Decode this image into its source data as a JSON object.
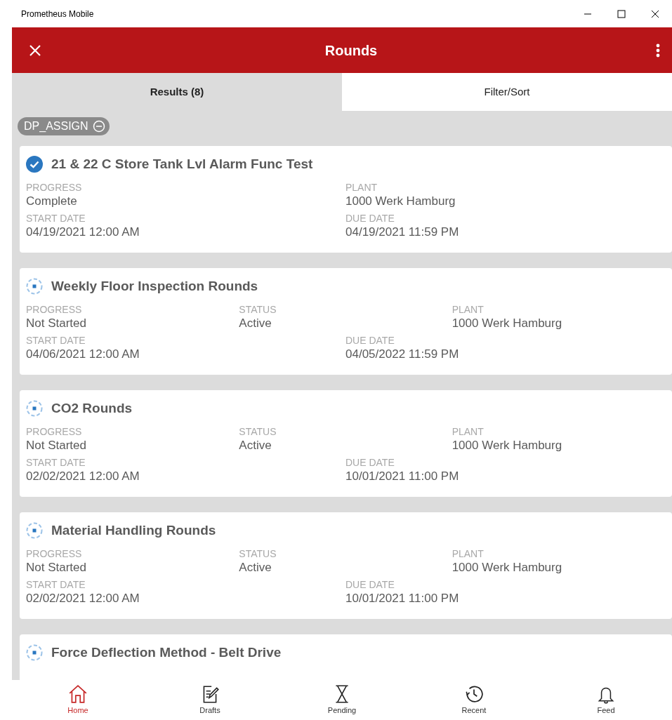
{
  "window": {
    "title": "Prometheus Mobile"
  },
  "header": {
    "title": "Rounds"
  },
  "tabs": [
    {
      "label": "Results (8)",
      "selected": true
    },
    {
      "label": "Filter/Sort",
      "selected": false
    }
  ],
  "filter_chips": [
    {
      "label": "DP_ASSIGN"
    }
  ],
  "rounds": [
    {
      "kind": "complete",
      "title": "21 & 22 C Store Tank Lvl Alarm Func Test",
      "rows": [
        [
          {
            "label": "PROGRESS",
            "value": "Complete"
          },
          {
            "label": "PLANT",
            "value": "1000 Werk Hamburg"
          }
        ],
        [
          {
            "label": "START DATE",
            "value": "04/19/2021 12:00 AM"
          },
          {
            "label": "DUE DATE",
            "value": "04/19/2021 11:59 PM"
          }
        ]
      ]
    },
    {
      "kind": "not_started",
      "title": "Weekly Floor Inspection Rounds",
      "rows": [
        [
          {
            "label": "PROGRESS",
            "value": "Not Started"
          },
          {
            "label": "STATUS",
            "value": "Active"
          },
          {
            "label": "PLANT",
            "value": "1000 Werk Hamburg"
          }
        ],
        [
          {
            "label": "START DATE",
            "value": "04/06/2021 12:00 AM"
          },
          {
            "label": "DUE DATE",
            "value": "04/05/2022 11:59 PM"
          }
        ]
      ]
    },
    {
      "kind": "not_started",
      "title": "CO2 Rounds",
      "rows": [
        [
          {
            "label": "PROGRESS",
            "value": "Not Started"
          },
          {
            "label": "STATUS",
            "value": "Active"
          },
          {
            "label": "PLANT",
            "value": "1000 Werk Hamburg"
          }
        ],
        [
          {
            "label": "START DATE",
            "value": "02/02/2021 12:00 AM"
          },
          {
            "label": "DUE DATE",
            "value": "10/01/2021 11:00 PM"
          }
        ]
      ]
    },
    {
      "kind": "not_started",
      "title": "Material Handling Rounds",
      "rows": [
        [
          {
            "label": "PROGRESS",
            "value": "Not Started"
          },
          {
            "label": "STATUS",
            "value": "Active"
          },
          {
            "label": "PLANT",
            "value": "1000 Werk Hamburg"
          }
        ],
        [
          {
            "label": "START DATE",
            "value": "02/02/2021 12:00 AM"
          },
          {
            "label": "DUE DATE",
            "value": "10/01/2021 11:00 PM"
          }
        ]
      ]
    },
    {
      "kind": "not_started",
      "title": "Force Deflection Method - Belt Drive"
    }
  ],
  "bottom_nav": [
    {
      "kind": "home",
      "label": "Home",
      "selected": true
    },
    {
      "kind": "drafts",
      "label": "Drafts",
      "selected": false
    },
    {
      "kind": "pending",
      "label": "Pending",
      "selected": false
    },
    {
      "kind": "recent",
      "label": "Recent",
      "selected": false
    },
    {
      "kind": "feed",
      "label": "Feed",
      "selected": false
    }
  ]
}
